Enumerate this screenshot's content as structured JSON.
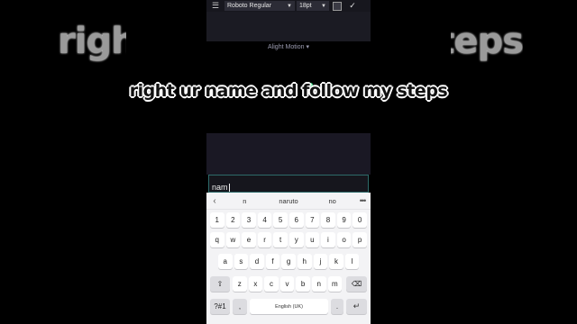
{
  "background_captions": {
    "left": "right",
    "right": "steps"
  },
  "caption": "right ur name and follow my steps",
  "toolbar": {
    "font_name": "Roboto Regular",
    "font_size": "18pt"
  },
  "watermark": "Alight Motion ▾",
  "input": {
    "value": "nam"
  },
  "suggestions": [
    "n",
    "naruto",
    "no"
  ],
  "keyboard": {
    "row_numbers": [
      "1",
      "2",
      "3",
      "4",
      "5",
      "6",
      "7",
      "8",
      "9",
      "0"
    ],
    "row_top": [
      "q",
      "w",
      "e",
      "r",
      "t",
      "y",
      "u",
      "i",
      "o",
      "p"
    ],
    "row_mid": [
      "a",
      "s",
      "d",
      "f",
      "g",
      "h",
      "j",
      "k",
      "l"
    ],
    "row_bottom": [
      "z",
      "x",
      "c",
      "v",
      "b",
      "n",
      "m"
    ],
    "symbols_label": "?#1",
    "comma_label": ",",
    "space_label": "English (UK)",
    "period_label": "."
  },
  "colors": {
    "accent_green": "#3ddc84",
    "input_border": "#2d6b6a"
  }
}
